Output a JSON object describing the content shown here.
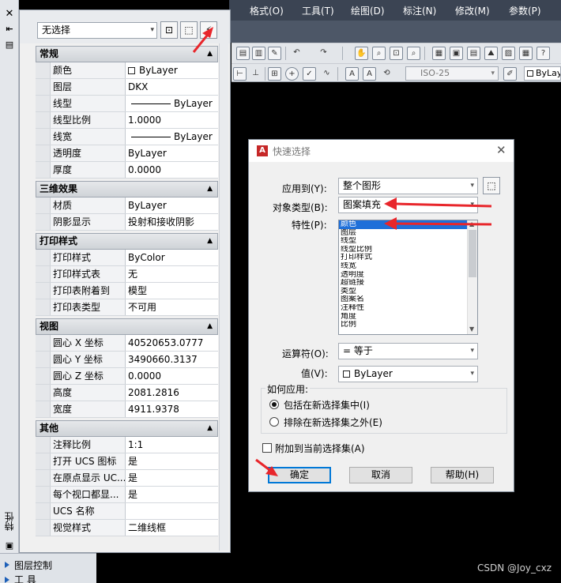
{
  "menubar": {
    "items": [
      "格式(O)",
      "工具(T)",
      "绘图(D)",
      "标注(N)",
      "修改(M)",
      "参数(P)"
    ]
  },
  "toolbar": {
    "dim_style": "ISO-25",
    "color_value": "ByLayer"
  },
  "left_strip": {
    "vertical_label": "特性"
  },
  "bottom_panel": {
    "items": [
      "图层控制",
      "工  具"
    ]
  },
  "watermark": "CSDN @Joy_cxz",
  "properties": {
    "selection": "无选择",
    "sections": [
      {
        "title": "常规",
        "rows": [
          {
            "label": "颜色",
            "value": "ByLayer",
            "swatch": true
          },
          {
            "label": "图层",
            "value": "DKX"
          },
          {
            "label": "线型",
            "value": "ByLayer",
            "line": true
          },
          {
            "label": "线型比例",
            "value": "1.0000"
          },
          {
            "label": "线宽",
            "value": "ByLayer",
            "line": true
          },
          {
            "label": "透明度",
            "value": "ByLayer"
          },
          {
            "label": "厚度",
            "value": "0.0000"
          }
        ]
      },
      {
        "title": "三维效果",
        "rows": [
          {
            "label": "材质",
            "value": "ByLayer"
          },
          {
            "label": "阴影显示",
            "value": "投射和接收阴影"
          }
        ]
      },
      {
        "title": "打印样式",
        "rows": [
          {
            "label": "打印样式",
            "value": "ByColor"
          },
          {
            "label": "打印样式表",
            "value": "无"
          },
          {
            "label": "打印表附着到",
            "value": "模型"
          },
          {
            "label": "打印表类型",
            "value": "不可用"
          }
        ]
      },
      {
        "title": "视图",
        "rows": [
          {
            "label": "圆心 X 坐标",
            "value": "40520653.0777"
          },
          {
            "label": "圆心 Y 坐标",
            "value": "3490660.3137"
          },
          {
            "label": "圆心 Z 坐标",
            "value": "0.0000"
          },
          {
            "label": "高度",
            "value": "2081.2816"
          },
          {
            "label": "宽度",
            "value": "4911.9378"
          }
        ]
      },
      {
        "title": "其他",
        "rows": [
          {
            "label": "注释比例",
            "value": "1:1"
          },
          {
            "label": "打开 UCS 图标",
            "value": "是"
          },
          {
            "label": "在原点显示 UC...",
            "value": "是"
          },
          {
            "label": "每个视口都显...",
            "value": "是"
          },
          {
            "label": "UCS 名称",
            "value": ""
          },
          {
            "label": "视觉样式",
            "value": "二维线框"
          }
        ]
      }
    ]
  },
  "quick_select": {
    "title": "快速选择",
    "apply_to_label": "应用到(Y):",
    "apply_to_value": "整个图形",
    "object_type_label": "对象类型(B):",
    "object_type_value": "图案填充",
    "properties_label": "特性(P):",
    "property_list": [
      "颜色",
      "图层",
      "线型",
      "线型比例",
      "打印样式",
      "线宽",
      "透明度",
      "超链接",
      "类型",
      "图案名",
      "注释性",
      "角度",
      "比例"
    ],
    "selected_property": "颜色",
    "operator_label": "运算符(O):",
    "operator_value": "= 等于",
    "value_label": "值(V):",
    "value_value": "ByLayer",
    "how_apply_label": "如何应用:",
    "include_label": "包括在新选择集中(I)",
    "exclude_label": "排除在新选择集之外(E)",
    "append_label": "附加到当前选择集(A)",
    "ok_label": "确定",
    "cancel_label": "取消",
    "help_label": "帮助(H)"
  }
}
